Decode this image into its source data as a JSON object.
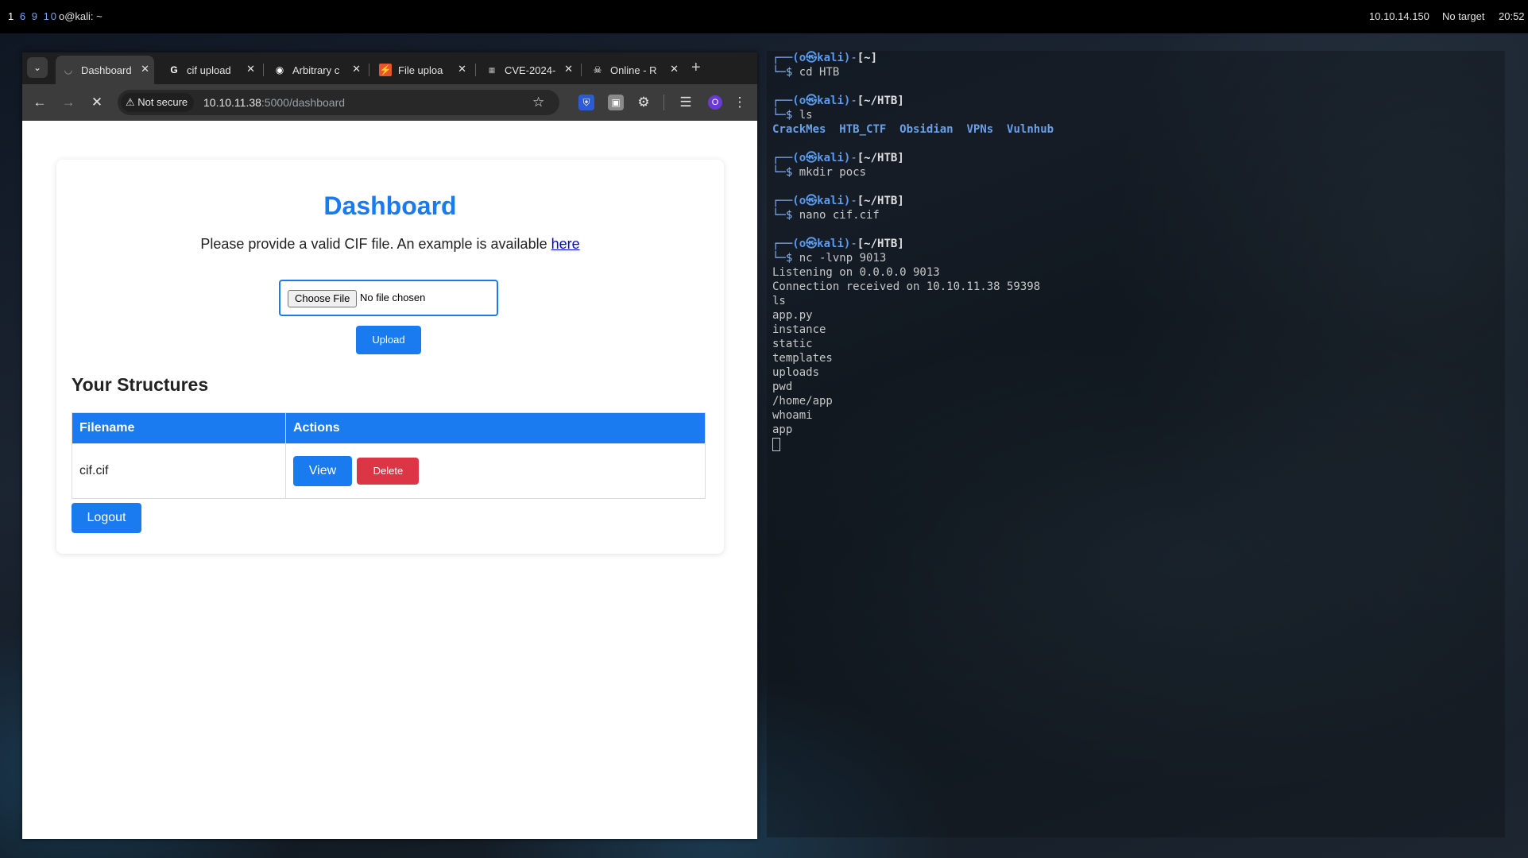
{
  "panel": {
    "workspaces": [
      "1",
      "6",
      "9",
      "10"
    ],
    "user": "o@kali: ~",
    "ip": "10.10.14.150",
    "target": "No target",
    "clock": "20:52"
  },
  "browser": {
    "tabs": [
      {
        "title": "Dashboard",
        "icon": "loading-icon"
      },
      {
        "title": "cif upload",
        "icon": "google-icon"
      },
      {
        "title": "Arbitrary c",
        "icon": "github-icon"
      },
      {
        "title": "File uploa",
        "icon": "exploit-icon"
      },
      {
        "title": "CVE-2024-",
        "icon": "cve-icon"
      },
      {
        "title": "Online - R",
        "icon": "skull-icon"
      }
    ],
    "security_label": "Not secure",
    "url_host": "10.10.11.38",
    "url_path": ":5000/dashboard",
    "profile_initial": "O"
  },
  "page": {
    "title": "Dashboard",
    "intro": "Please provide a valid CIF file. An example is available ",
    "intro_link": "here",
    "choose_label": "Choose File",
    "no_file": "No file chosen",
    "upload_label": "Upload",
    "structures_heading": "Your Structures",
    "table": {
      "columns": [
        "Filename",
        "Actions"
      ],
      "rows": [
        {
          "filename": "cif.cif",
          "view_label": "View",
          "delete_label": "Delete"
        }
      ]
    },
    "logout_label": "Logout"
  },
  "terminal": {
    "prompt_user": "(o㉿kali)",
    "home_path": "[~]",
    "htb_path": "[~/HTB]",
    "cmds": [
      "cd HTB",
      "ls",
      "mkdir pocs",
      "nano cif.cif",
      "nc -lvnp 9013"
    ],
    "ls_dirs": [
      "CrackMes",
      "HTB_CTF",
      "Obsidian",
      "VPNs",
      "Vulnhub"
    ],
    "output": [
      "Listening on 0.0.0.0 9013",
      "Connection received on 10.10.11.38 59398",
      "ls",
      "app.py",
      "instance",
      "static",
      "templates",
      "uploads",
      "pwd",
      "/home/app",
      "whoami",
      "app"
    ]
  },
  "colors": {
    "primary": "#1a7bf0",
    "danger": "#dc3545",
    "terminal_dir": "#6aa0e8"
  }
}
